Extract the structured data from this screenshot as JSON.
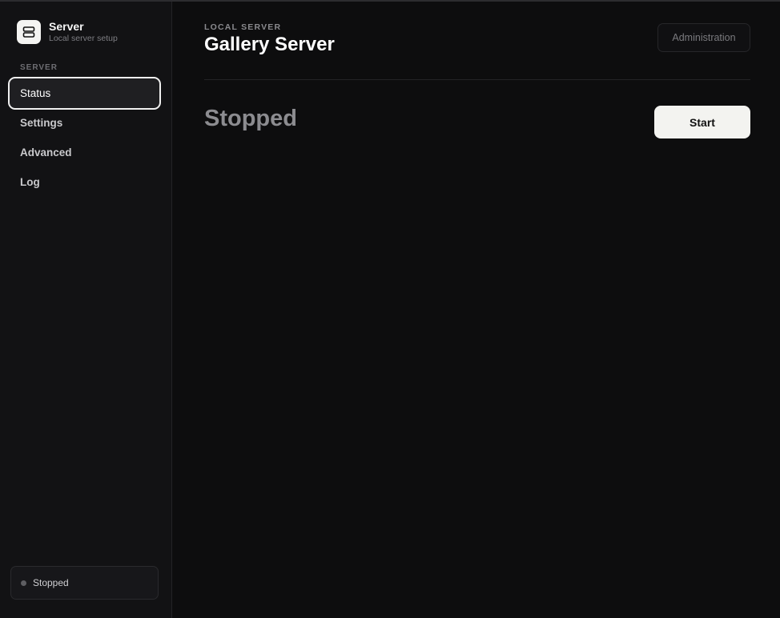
{
  "brand": {
    "title": "Server",
    "subtitle": "Local server setup",
    "logo_icon": "server-icon"
  },
  "sidebar": {
    "section_label": "SERVER",
    "items": [
      {
        "label": "Status",
        "active": true
      },
      {
        "label": "Settings",
        "active": false
      },
      {
        "label": "Advanced",
        "active": false
      },
      {
        "label": "Log",
        "active": false
      }
    ],
    "status_card": {
      "text": "Stopped",
      "dot_color": "#5e5e62"
    }
  },
  "header": {
    "eyebrow": "LOCAL SERVER",
    "title": "Gallery Server",
    "admin_label": "Administration"
  },
  "main": {
    "state_label": "Stopped",
    "start_label": "Start"
  },
  "colors": {
    "background": "#0d0d0e",
    "sidebar": "#121214",
    "accent_button": "#f3f3f0"
  }
}
